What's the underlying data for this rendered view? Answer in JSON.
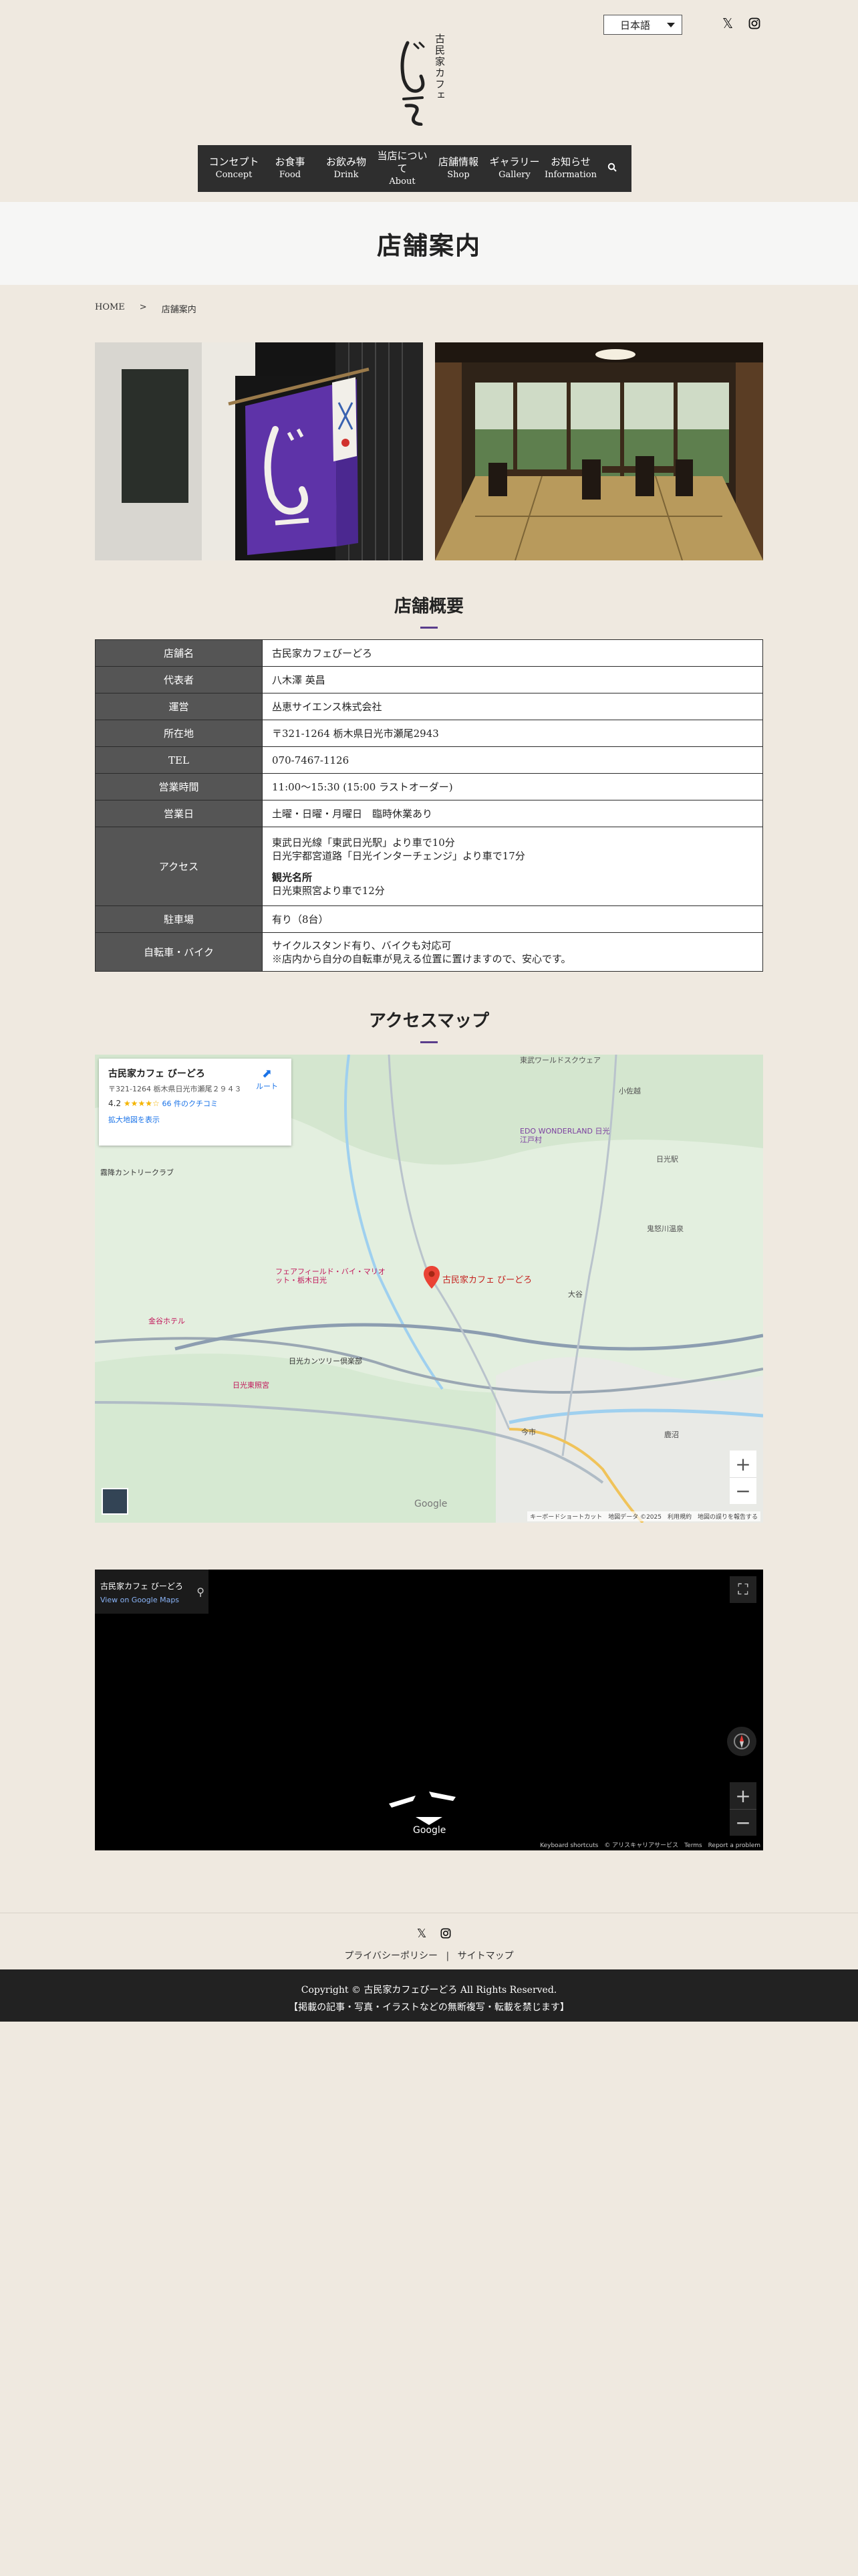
{
  "header": {
    "language": "日本語",
    "logo_small": "古民家カフェ",
    "logo_main": "びーどろ",
    "social": {
      "x_icon": "x-icon",
      "instagram_icon": "instagram-icon"
    }
  },
  "nav": {
    "items": [
      {
        "ja": "コンセプト",
        "en": "Concept"
      },
      {
        "ja": "お食事",
        "en": "Food"
      },
      {
        "ja": "お飲み物",
        "en": "Drink"
      },
      {
        "ja": "当店について",
        "en": "About"
      },
      {
        "ja": "店舗情報",
        "en": "Shop"
      },
      {
        "ja": "ギャラリー",
        "en": "Gallery"
      },
      {
        "ja": "お知らせ",
        "en": "Information"
      }
    ],
    "search_icon": "search-icon"
  },
  "page": {
    "title": "店舗案内",
    "breadcrumb": {
      "home": "HOME",
      "sep": ">",
      "current": "店舗案内"
    }
  },
  "overview": {
    "title": "店舗概要",
    "rows": [
      {
        "label": "店舗名",
        "value": "古民家カフェびーどろ"
      },
      {
        "label": "代表者",
        "value": "八木澤 英昌"
      },
      {
        "label": "運営",
        "value": "丛恵サイエンス株式会社"
      },
      {
        "label": "所在地",
        "value": "〒321-1264 栃木県日光市瀬尾2943"
      },
      {
        "label": "TEL",
        "value": "070-7467-1126"
      },
      {
        "label": "営業時間",
        "value": "11:00〜15:30 (15:00 ラストオーダー)"
      },
      {
        "label": "営業日",
        "value": "土曜・日曜・月曜日　臨時休業あり"
      },
      {
        "label": "アクセス",
        "lines": [
          "東武日光線「東武日光駅」より車で10分",
          "日光宇都宮道路「日光インターチェンジ」より車で17分",
          "",
          "観光名所",
          "日光東照宮より車で12分"
        ]
      },
      {
        "label": "駐車場",
        "value": "有り（8台）"
      },
      {
        "label": "自転車・バイク",
        "lines": [
          "サイクルスタンド有り、バイクも対応可",
          "※店内から自分の自転車が見える位置に置けますので、安心です。"
        ]
      }
    ]
  },
  "access": {
    "title": "アクセスマップ",
    "map_card": {
      "name": "古民家カフェ びーどろ",
      "address": "〒321-1264 栃木県日光市瀬尾２９４３",
      "rating": "4.2",
      "stars": "★★★★☆",
      "reviews": "66 件のクチコミ",
      "enlarge": "拡大地図を表示",
      "route": "ルート"
    },
    "map_labels": {
      "pin": "古民家カフェ びーどろ",
      "edo": "EDO WONDERLAND 日光江戸村",
      "tobu_world": "東武ワールドスクウェア",
      "kosaka": "小佐越",
      "kirifuri": "霧降カントリークラブ",
      "nikko_station": "日光駅",
      "kinugawa": "鬼怒川温泉",
      "fairfield": "フェアフィールド・バイ・マリオット・栃木日光",
      "kaneda": "金谷ホテル",
      "toshogu": "日光東照宮",
      "imaichi": "今市",
      "oya": "大谷",
      "kanuma": "鹿沼",
      "nikko_country": "日光カンツリー倶楽部",
      "footer": "キーボードショートカット　地図データ ©2025　利用規約　地図の誤りを報告する",
      "google": "Google",
      "zoom_in": "+",
      "zoom_out": "−"
    },
    "streetview": {
      "title": "古民家カフェ びーどろ",
      "link": "View on Google Maps",
      "google": "Google",
      "footer": "Keyboard shortcuts　© アリスキャリアサービス　Terms　Report a problem",
      "zoom_in": "+",
      "zoom_out": "−",
      "fullscreen": "⛶"
    }
  },
  "footer": {
    "privacy": "プライバシーポリシー",
    "sep": "|",
    "sitemap": "サイトマップ",
    "copyright": "Copyright © 古民家カフェびーどろ All Rights Reserved.",
    "notice": "【掲載の記事・写真・イラストなどの無断複写・転載を禁じます】"
  },
  "colors": {
    "background": "#efe9e0",
    "nav_bg": "#2e2e2e",
    "accent_purple": "#5a3d8c",
    "table_header": "#555555",
    "footer_bg": "#222222"
  }
}
